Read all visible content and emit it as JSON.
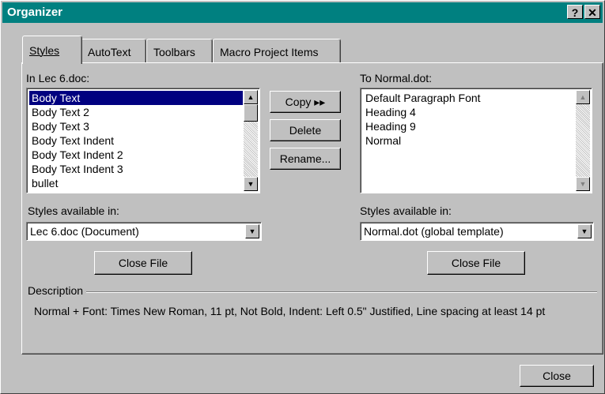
{
  "window": {
    "title": "Organizer",
    "help_label": "?",
    "close_label": "✕"
  },
  "tabs": [
    {
      "label": "Styles",
      "active": true
    },
    {
      "label": "AutoText",
      "active": false
    },
    {
      "label": "Toolbars",
      "active": false
    },
    {
      "label": "Macro Project Items",
      "active": false
    }
  ],
  "left": {
    "heading": "In Lec 6.doc:",
    "items": [
      "Body Text",
      "Body Text 2",
      "Body Text 3",
      "Body Text Indent",
      "Body Text Indent 2",
      "Body Text Indent 3",
      "bullet"
    ],
    "selected_index": 0,
    "available_label": "Styles available in:",
    "available_value": "Lec 6.doc (Document)",
    "close_file_label": "Close File"
  },
  "right": {
    "heading": "To Normal.dot:",
    "items": [
      "Default Paragraph Font",
      "Heading 4",
      "Heading 9",
      "Normal"
    ],
    "available_label": "Styles available in:",
    "available_value": "Normal.dot (global template)",
    "close_file_label": "Close File"
  },
  "actions": {
    "copy_label": "Copy ▸▸",
    "delete_label": "Delete",
    "rename_label": "Rename..."
  },
  "description": {
    "label": "Description",
    "text": "Normal + Font: Times New Roman, 11 pt, Not Bold, Indent:  Left  0.5\" Justified, Line spacing at least 14 pt"
  },
  "footer": {
    "close_label": "Close"
  },
  "icons": {
    "up": "scroll-up-icon",
    "down": "scroll-down-icon",
    "dropdown": "chevron-down-icon"
  }
}
